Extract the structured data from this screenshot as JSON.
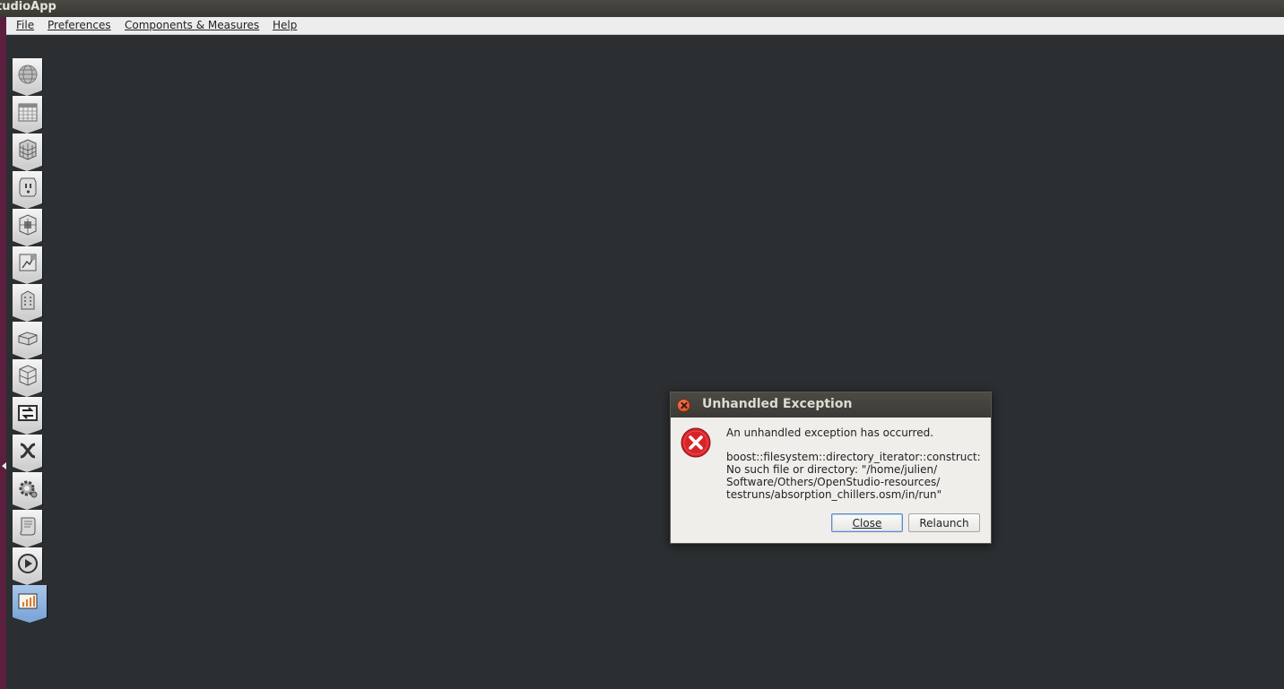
{
  "window": {
    "title": "tudioApp"
  },
  "menubar": {
    "items": [
      {
        "label": "File"
      },
      {
        "label": "Preferences"
      },
      {
        "label": "Components & Measures"
      },
      {
        "label": "Help"
      }
    ]
  },
  "sidebar": {
    "tabs": [
      {
        "icon": "globe-icon",
        "selected": false
      },
      {
        "icon": "calendar-icon",
        "selected": false
      },
      {
        "icon": "bricks-icon",
        "selected": false
      },
      {
        "icon": "outlet-icon",
        "selected": false
      },
      {
        "icon": "space-types-icon",
        "selected": false
      },
      {
        "icon": "facility-icon",
        "selected": false
      },
      {
        "icon": "building-icon",
        "selected": false
      },
      {
        "icon": "spaces-icon",
        "selected": false
      },
      {
        "icon": "thermal-zones-icon",
        "selected": false
      },
      {
        "icon": "hvac-icon",
        "selected": false
      },
      {
        "icon": "variables-icon",
        "selected": false
      },
      {
        "icon": "settings-gear-icon",
        "selected": false
      },
      {
        "icon": "scripts-icon",
        "selected": false
      },
      {
        "icon": "run-icon",
        "selected": false
      },
      {
        "icon": "results-chart-icon",
        "selected": true
      }
    ]
  },
  "dialog": {
    "title": "Unhandled Exception",
    "message": "An unhandled exception has occurred.",
    "details": "boost::filesystem::directory_iterator::construct:\nNo such file or directory: \"/home/julien/\nSoftware/Others/OpenStudio-resources/\ntestruns/absorption_chillers.osm/in/run\"",
    "buttons": {
      "close": "Close",
      "relaunch": "Relaunch"
    }
  },
  "colors": {
    "background": "#2b2f31",
    "launcher": "#5b1f3f",
    "error_red": "#d9232a",
    "selected_tab": "#8fb2e0"
  }
}
